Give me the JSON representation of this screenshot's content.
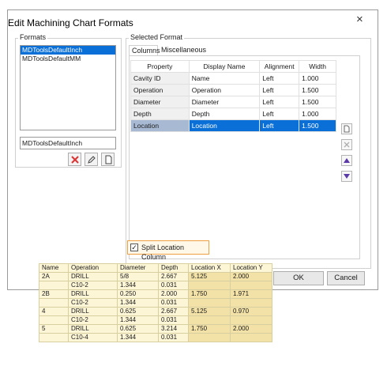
{
  "dialog": {
    "title": "Edit Machining Chart Formats",
    "close_label": "×",
    "ok_label": "OK",
    "cancel_label": "Cancel"
  },
  "formats": {
    "group_label": "Formats",
    "items": [
      {
        "label": "MDToolsDefaultInch",
        "selected": true
      },
      {
        "label": "MDToolsDefaultMM",
        "selected": false
      }
    ],
    "name_value": "MDToolsDefaultInch",
    "icons": [
      "delete-icon",
      "edit-icon",
      "new-icon"
    ]
  },
  "selected_format": {
    "group_label": "Selected Format",
    "tabs": [
      {
        "label": "Columns",
        "active": true
      },
      {
        "label": "Miscellaneous",
        "active": false
      }
    ],
    "columns": [
      "Property",
      "Display Name",
      "Alignment",
      "Width"
    ],
    "rows": [
      {
        "property": "Cavity ID",
        "display": "Name",
        "align": "Left",
        "width": "1.000",
        "selected": false
      },
      {
        "property": "Operation",
        "display": "Operation",
        "align": "Left",
        "width": "1.500",
        "selected": false
      },
      {
        "property": "Diameter",
        "display": "Diameter",
        "align": "Left",
        "width": "1.500",
        "selected": false
      },
      {
        "property": "Depth",
        "display": "Depth",
        "align": "Left",
        "width": "1.000",
        "selected": false
      },
      {
        "property": "Location",
        "display": "Location",
        "align": "Left",
        "width": "1.500",
        "selected": true
      }
    ],
    "side_icons": [
      "new-icon",
      "delete-icon",
      "move-up-icon",
      "move-down-icon"
    ],
    "split_location": {
      "label": "Split Location Column",
      "checked": true
    }
  },
  "output_table": {
    "headers": [
      "Name",
      "Operation",
      "Diameter",
      "Depth",
      "Location X",
      "Location Y"
    ],
    "rows": [
      [
        "2A",
        "DRILL",
        "5/8",
        "2.667",
        "5.125",
        "2.000"
      ],
      [
        "",
        "C10-2",
        "1.344",
        "0.031",
        "",
        ""
      ],
      [
        "2B",
        "DRILL",
        "0.250",
        "2.000",
        "1.750",
        "1.971"
      ],
      [
        "",
        "C10-2",
        "1.344",
        "0.031",
        "",
        ""
      ],
      [
        "4",
        "DRILL",
        "0.625",
        "2.667",
        "5.125",
        "0.970"
      ],
      [
        "",
        "C10-2",
        "1.344",
        "0.031",
        "",
        ""
      ],
      [
        "5",
        "DRILL",
        "0.625",
        "3.214",
        "1.750",
        "2.000"
      ],
      [
        "",
        "C10-4",
        "1.344",
        "0.031",
        "",
        ""
      ]
    ]
  },
  "colors": {
    "selection": "#0a6fd6",
    "highlight_border": "#f0a040",
    "output_background": "#fdf6d6",
    "location_highlight": "#f3e2a8"
  }
}
